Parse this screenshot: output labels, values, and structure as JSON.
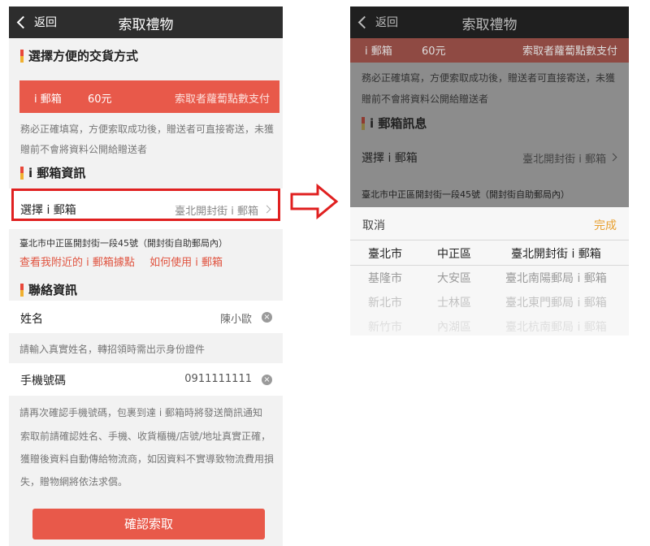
{
  "left": {
    "nav": {
      "back_label": "返回",
      "title": "索取禮物"
    },
    "delivery": {
      "heading": "選擇方便的交貨方式",
      "option": "i 郵箱",
      "price": "60元",
      "payment": "索取者蘿蔔點數支付"
    },
    "notice": [
      "務必正確填寫，方便索取成功後，贈送者可直接寄送，未獲",
      "贈前不會將資料公開給贈送者"
    ],
    "mailbox": {
      "heading": "i 郵箱資訊",
      "select_label": "選擇 i 郵箱",
      "select_value": "臺北開封街 i 郵箱",
      "address": "臺北市中正區開封街一段45號（開封街自助郵局內）",
      "link_nearby": "查看我附近的 i 郵箱據點",
      "link_howto": "如何使用 i 郵箱"
    },
    "contact": {
      "heading": "聯絡資訊",
      "name_label": "姓名",
      "name_value": "陳小歐",
      "name_hint": "請輸入真實姓名，轉招領時需出示身份證件",
      "phone_label": "手機號碼",
      "phone_value": "0911111111",
      "phone_hint": "請再次確認手機號碼，包裹到達 i 郵箱時將發送簡訊通知"
    },
    "disclaimer": [
      "索取前請確認姓名、手機、收貨櫃機/店號/地址真實正確，",
      "獲贈後資料自動傳給物流商，如因資料不實導致物流費用損",
      "失，贈物網將依法求償。"
    ],
    "confirm_button": "確認索取"
  },
  "right": {
    "nav": {
      "back_label": "返回",
      "title": "索取禮物"
    },
    "delivery": {
      "option": "i 郵箱",
      "price": "60元",
      "payment": "索取者蘿蔔點數支付"
    },
    "notice": [
      "務必正確填寫，方便索取成功後，贈送者可直接寄送，未獲",
      "贈前不會將資料公開給贈送者"
    ],
    "mailbox": {
      "heading": "i 郵箱訊息",
      "select_label": "選擇 i 郵箱",
      "select_value": "臺北開封街 i 郵箱",
      "address": "臺北市中正區開封街一段45號（開封街自助郵局內）"
    },
    "picker": {
      "cancel": "取消",
      "done": "完成",
      "rows": [
        {
          "city": "臺北市",
          "district": "中正區",
          "box": "臺北開封街 i 郵箱"
        },
        {
          "city": "基隆市",
          "district": "大安區",
          "box": "臺北南陽郵局 i 郵箱"
        },
        {
          "city": "新北市",
          "district": "士林區",
          "box": "臺北東門郵局 i 郵箱"
        },
        {
          "city": "新竹市",
          "district": "內湖區",
          "box": "臺北杭南郵局 i 郵箱"
        }
      ]
    }
  },
  "colors": {
    "accent": "#e8594a",
    "highlight": "#e02020",
    "done": "#e8a030",
    "nav": "#2d2d2d"
  }
}
